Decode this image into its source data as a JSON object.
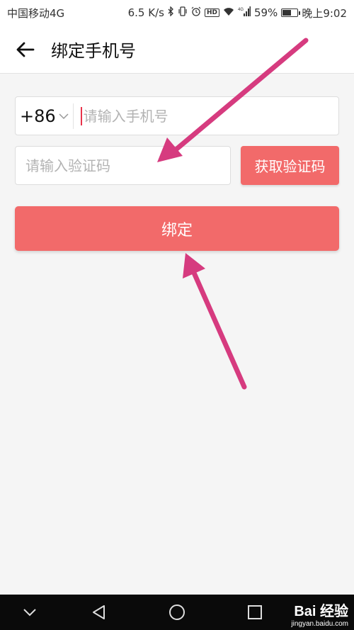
{
  "status_bar": {
    "carrier": "中国移动4G",
    "speed": "6.5 K/s",
    "hd": "HD",
    "network": "4G",
    "battery": "59%",
    "battery_level": 0.59,
    "time": "晚上9:02"
  },
  "header": {
    "title": "绑定手机号",
    "back_icon": "arrow-left-icon"
  },
  "form": {
    "country_code": "+86",
    "phone_placeholder": "请输入手机号",
    "code_placeholder": "请输入验证码",
    "get_code_label": "获取验证码",
    "bind_label": "绑定"
  },
  "nav_bar": {
    "icons": [
      "chevron-down-icon",
      "back-triangle-icon",
      "home-circle-icon",
      "recent-square-icon"
    ]
  },
  "watermark": {
    "main": "Bai 经验",
    "sub": "jingyan.baidu.com"
  },
  "colors": {
    "accent": "#f26a6a",
    "annotation_arrow": "#d63b7f",
    "background": "#f5f5f5"
  }
}
